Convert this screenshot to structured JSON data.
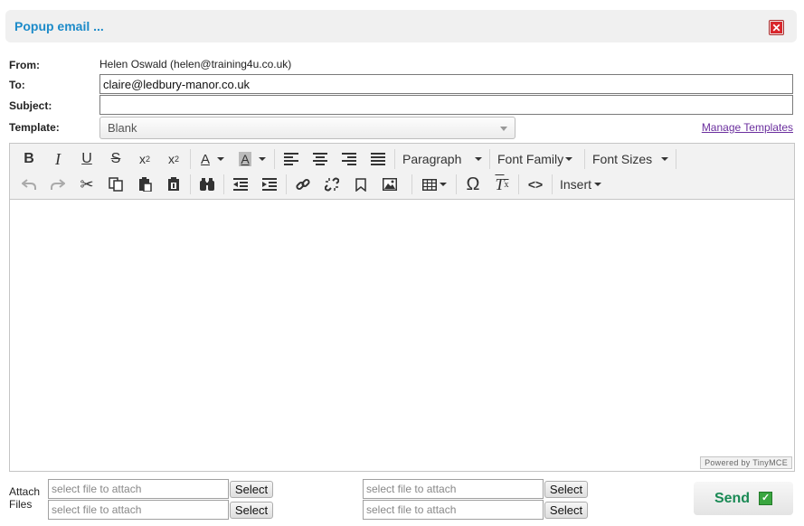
{
  "window": {
    "title": "Popup email ..."
  },
  "form": {
    "from_label": "From:",
    "from_value": "Helen Oswald (helen@training4u.co.uk)",
    "to_label": "To:",
    "to_value": "claire@ledbury-manor.co.uk",
    "subject_label": "Subject:",
    "subject_value": "",
    "template_label": "Template:",
    "template_selected": "Blank",
    "manage_templates_label": "Manage Templates"
  },
  "editor": {
    "menus": {
      "paragraph": "Paragraph",
      "font_family": "Font Family",
      "font_sizes": "Font Sizes",
      "insert": "Insert"
    },
    "powered_by": "Powered by TinyMCE"
  },
  "attach": {
    "label_line1": "Attach",
    "label_line2": "Files",
    "placeholder": "select file to attach",
    "select_label": "Select"
  },
  "send": {
    "label": "Send"
  },
  "colors": {
    "title": "#1d8bc9",
    "send_text": "#1a8a55",
    "link": "#6b2f9e",
    "close": "#d9262c"
  }
}
